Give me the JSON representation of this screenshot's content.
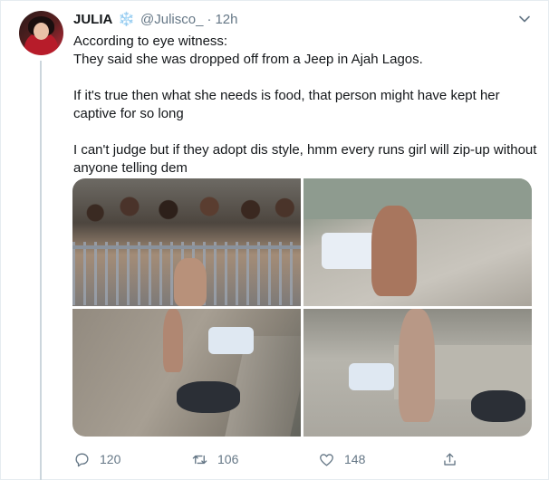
{
  "tweet": {
    "display_name": "JULIA",
    "badge_emoji": "❄️",
    "handle": "@Julisco_",
    "separator": "·",
    "time": "12h",
    "paragraphs": [
      "According to eye witness:\nThey said she was dropped off from a Jeep in Ajah Lagos.",
      "If it's true then what she needs is food, that person might have kept her captive for so long",
      "I can't judge but if they adopt dis style, hmm every runs girl will zip-up without anyone telling dem"
    ]
  },
  "media": {
    "photos": 4
  },
  "actions": {
    "replies": "120",
    "retweets": "106",
    "likes": "148"
  },
  "icons": [
    "chevron-down-icon",
    "snowflake-icon",
    "reply-icon",
    "retweet-icon",
    "like-icon",
    "share-icon"
  ],
  "colors": {
    "text": "#14171a",
    "secondary": "#657786",
    "border": "#e6ecf0",
    "thread_line": "#ccd6dd"
  }
}
